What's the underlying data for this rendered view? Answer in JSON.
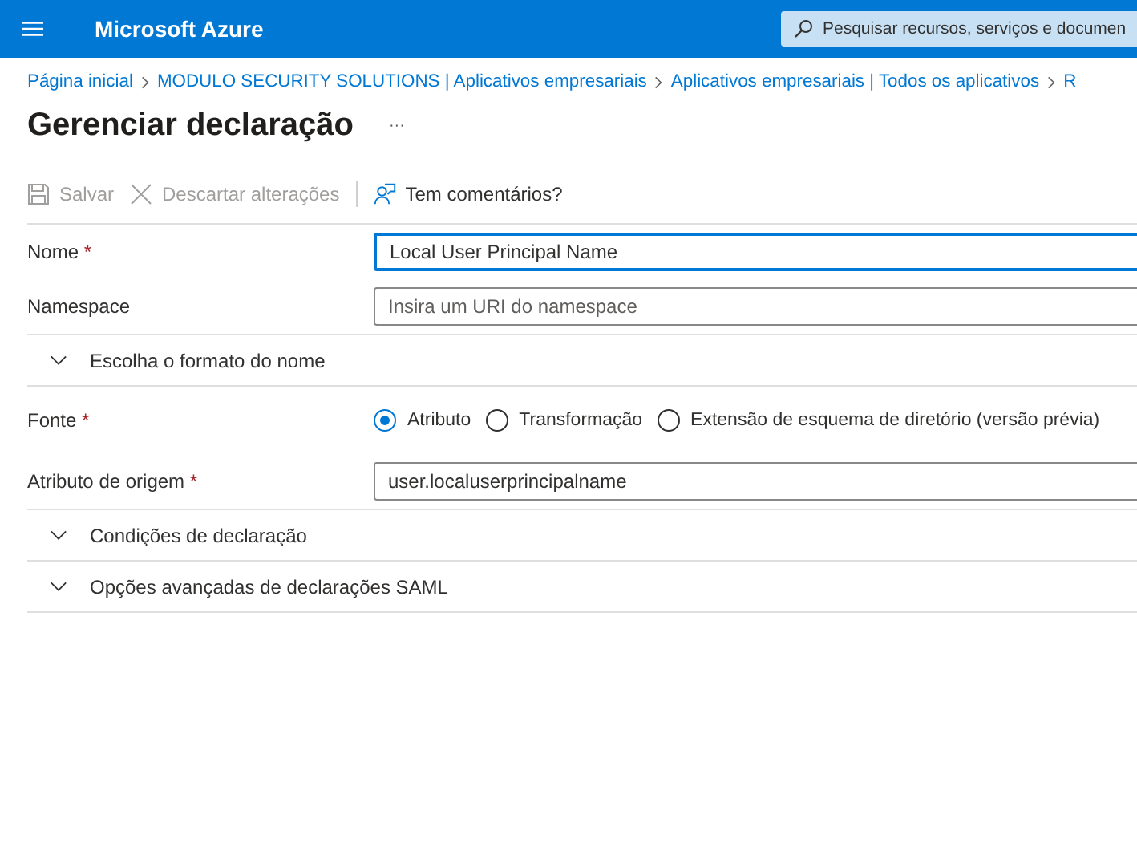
{
  "topbar": {
    "title": "Microsoft Azure",
    "search": {
      "placeholder": "Pesquisar recursos, serviços e documen"
    }
  },
  "breadcrumb": [
    "Página inicial",
    "MODULO SECURITY SOLUTIONS | Aplicativos empresariais",
    "Aplicativos empresariais | Todos os aplicativos",
    "R"
  ],
  "page": {
    "title": "Gerenciar declaração",
    "more": "···"
  },
  "toolbar": [
    {
      "kind": "save",
      "label": "Salvar",
      "disabled": true
    },
    {
      "kind": "discard",
      "label": "Descartar alterações",
      "disabled": true
    },
    {
      "kind": "feedback",
      "label": "Tem comentários?",
      "disabled": false
    }
  ],
  "form": {
    "name": {
      "label": "Nome",
      "required_mark": "*",
      "value": "Local User Principal Name"
    },
    "namespace": {
      "label": "Namespace",
      "placeholder": "Insira um URI do namespace"
    },
    "name_format": {
      "label": "Escolha o formato do nome",
      "expanded": false
    },
    "source": {
      "label": "Fonte",
      "required_mark": "*",
      "options": [
        {
          "label": "Atributo",
          "selected": true
        },
        {
          "label": "Transformação",
          "selected": false
        },
        {
          "label": "Extensão de esquema de diretório (versão prévia)",
          "selected": false
        }
      ]
    },
    "source_attribute": {
      "label": "Atributo de origem",
      "required_mark": "*",
      "value": "user.localuserprincipalname"
    },
    "sections": [
      {
        "label": "Condições de declaração",
        "expanded": false
      },
      {
        "label": "Opções avançadas de declarações SAML",
        "expanded": false
      }
    ]
  }
}
